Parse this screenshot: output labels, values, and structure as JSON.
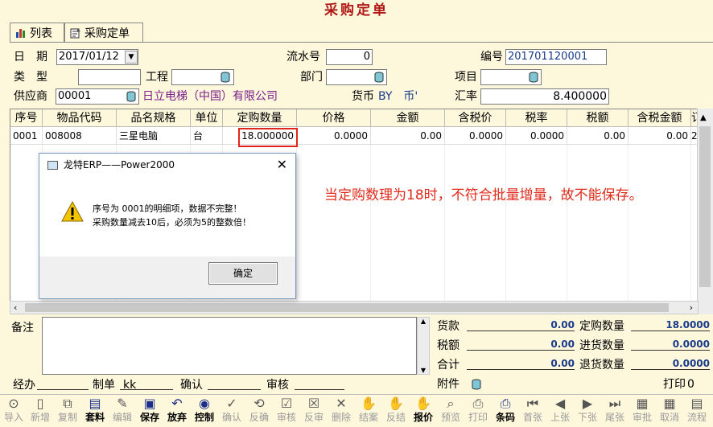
{
  "window": {
    "title": "采购定单"
  },
  "tabs": [
    {
      "label": "列表"
    },
    {
      "label": "采购定单"
    }
  ],
  "header": {
    "date_label": "日　期",
    "date_value": "2017/01/12",
    "serial_label": "流水号",
    "serial_value": "0",
    "number_label": "编号",
    "number_value": "201701120001",
    "type_label": "类　型",
    "type_value": "",
    "project_label": "工程",
    "project_value": "",
    "dept_label": "部门",
    "dept_value": "",
    "item_label": "项目",
    "item_value": "",
    "supplier_label": "供应商",
    "supplier_code": "00001",
    "supplier_name": "日立电梯（中国）有限公司",
    "currency_label": "货币",
    "currency_value": "BY　币'",
    "rate_label": "汇率",
    "rate_value": "8.400000"
  },
  "grid": {
    "columns": [
      "序号",
      "物品代码",
      "品名规格",
      "单位",
      "定购数量",
      "价格",
      "金额",
      "含税价",
      "税率",
      "税额",
      "含税金额",
      "订"
    ],
    "rows": [
      {
        "seq": "0001",
        "code": "008008",
        "name": "三星电脑",
        "unit": "台",
        "qty": "18.000000",
        "price": "0.0000",
        "amount": "0.00",
        "tax_price": "0.0000",
        "tax_rate": "0.0000",
        "tax": "0.00",
        "tax_amount": "0.00",
        "extra": "2"
      }
    ]
  },
  "dialog": {
    "title": "龙特ERP——Power2000",
    "line1": "序号为 0001的明细项，数据不完整！",
    "line2": "采购数量减去10后，必须为5的整数倍！",
    "ok_label": "确定"
  },
  "annotation": "当定购数理为18时，不符合批量增量，故不能保存。",
  "footer": {
    "remark_label": "备注",
    "remark_value": "",
    "goods_label": "货款",
    "goods_value": "0.00",
    "tax_label": "税额",
    "tax_value": "0.00",
    "total_label": "合计",
    "total_value": "0.00",
    "order_qty_label": "定购数量",
    "order_qty_value": "18.0000",
    "in_qty_label": "进货数量",
    "in_qty_value": "0.0000",
    "return_qty_label": "退货数量",
    "return_qty_value": "0.0000",
    "attach_label": "附件",
    "print_label": "打印",
    "print_count": "0",
    "handler_label": "经办",
    "handler_value": "",
    "maker_label": "制单",
    "maker_value": "kk",
    "confirm_label": "确认",
    "confirm_value": "",
    "audit_label": "审核",
    "audit_value": ""
  },
  "toolbar": [
    {
      "label": "导入",
      "icon": "import-icon",
      "enabled": false
    },
    {
      "label": "新增",
      "icon": "new-doc-icon",
      "enabled": false
    },
    {
      "label": "复制",
      "icon": "copy-icon",
      "enabled": false
    },
    {
      "label": "套料",
      "icon": "material-icon",
      "enabled": true
    },
    {
      "label": "编辑",
      "icon": "edit-icon",
      "enabled": false
    },
    {
      "label": "保存",
      "icon": "save-icon",
      "enabled": true
    },
    {
      "label": "放弃",
      "icon": "undo-icon",
      "enabled": true
    },
    {
      "label": "控制",
      "icon": "control-icon",
      "enabled": true
    },
    {
      "label": "确认",
      "icon": "confirm-icon",
      "enabled": false
    },
    {
      "label": "反确",
      "icon": "unconfirm-icon",
      "enabled": false
    },
    {
      "label": "审核",
      "icon": "audit-icon",
      "enabled": false
    },
    {
      "label": "反审",
      "icon": "unaudit-icon",
      "enabled": false
    },
    {
      "label": "删除",
      "icon": "delete-icon",
      "enabled": false
    },
    {
      "label": "结案",
      "icon": "close-case-icon",
      "enabled": false
    },
    {
      "label": "反结",
      "icon": "reopen-icon",
      "enabled": false
    },
    {
      "label": "报价",
      "icon": "quote-icon",
      "enabled": true
    },
    {
      "label": "预览",
      "icon": "preview-icon",
      "enabled": false
    },
    {
      "label": "打印",
      "icon": "printer-icon",
      "enabled": false
    },
    {
      "label": "条码",
      "icon": "barcode-printer-icon",
      "enabled": true
    },
    {
      "label": "首张",
      "icon": "first-icon",
      "enabled": false
    },
    {
      "label": "上张",
      "icon": "prev-icon",
      "enabled": false
    },
    {
      "label": "下张",
      "icon": "next-icon",
      "enabled": false
    },
    {
      "label": "尾张",
      "icon": "last-icon",
      "enabled": false
    },
    {
      "label": "审批",
      "icon": "approve-icon",
      "enabled": false
    },
    {
      "label": "取消",
      "icon": "cancel-icon",
      "enabled": false
    },
    {
      "label": "流程",
      "icon": "flow-icon",
      "enabled": false
    }
  ],
  "colors": {
    "title_red": "#b01818",
    "annotation_red": "#e02b1c",
    "value_blue": "#1a3a8a",
    "supplier_purple": "#7a1d8a",
    "background": "#fdf7dc"
  }
}
